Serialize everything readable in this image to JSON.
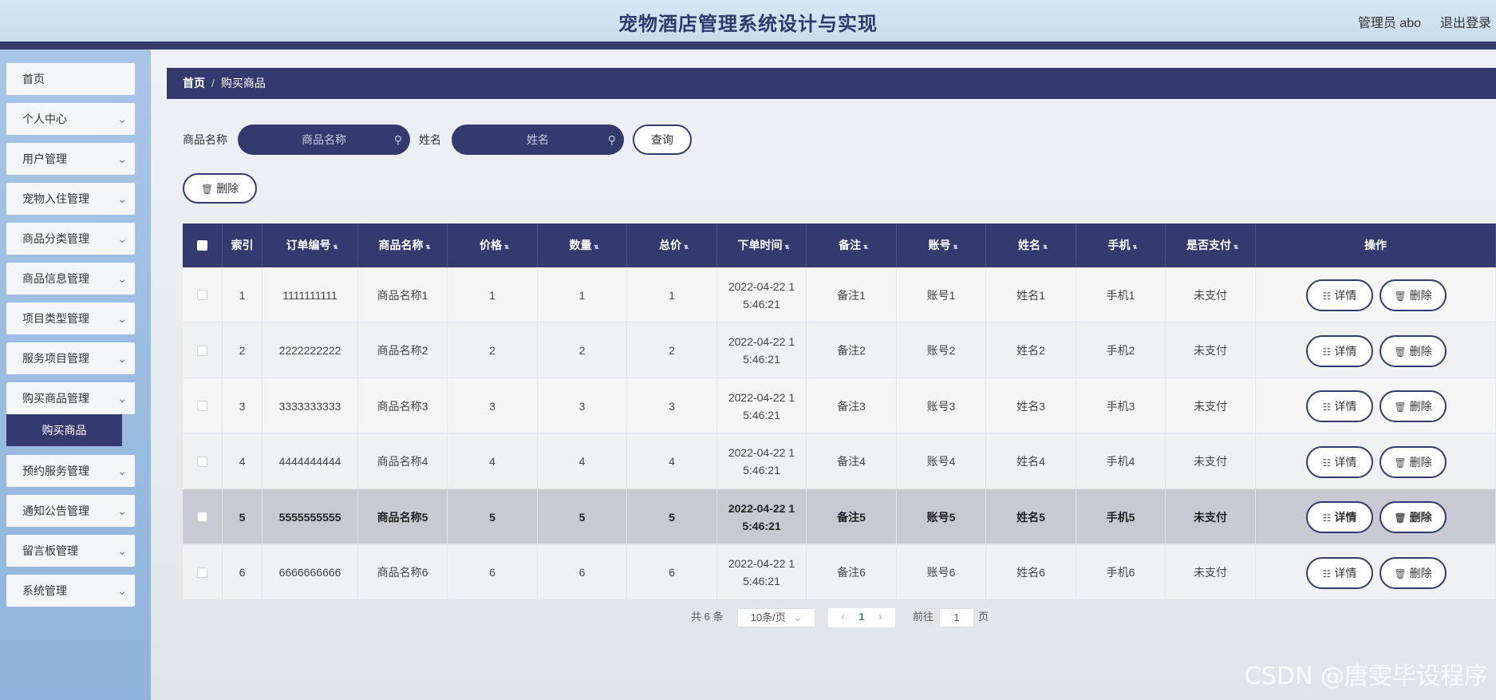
{
  "header": {
    "title": "宠物酒店管理系统设计与实现",
    "user": "管理员 abo",
    "logout": "退出登录"
  },
  "sidebar": {
    "items": [
      {
        "label": "首页",
        "chevron": false
      },
      {
        "label": "个人中心",
        "chevron": true
      },
      {
        "label": "用户管理",
        "chevron": true
      },
      {
        "label": "宠物入住管理",
        "chevron": true
      },
      {
        "label": "商品分类管理",
        "chevron": true
      },
      {
        "label": "商品信息管理",
        "chevron": true
      },
      {
        "label": "项目类型管理",
        "chevron": true
      },
      {
        "label": "服务项目管理",
        "chevron": true
      },
      {
        "label": "购买商品管理",
        "chevron": true
      },
      {
        "label": "预约服务管理",
        "chevron": true
      },
      {
        "label": "通知公告管理",
        "chevron": true
      },
      {
        "label": "留言板管理",
        "chevron": true
      },
      {
        "label": "系统管理",
        "chevron": true
      }
    ],
    "active_sub": "购买商品"
  },
  "breadcrumb": {
    "home": "首页",
    "separator": "/",
    "current": "购买商品"
  },
  "search": {
    "product_label": "商品名称",
    "product_placeholder": "商品名称",
    "name_label": "姓名",
    "name_placeholder": "姓名",
    "query_button": "查询",
    "delete_button": "删除"
  },
  "table": {
    "headers": [
      "索引",
      "订单编号",
      "商品名称",
      "价格",
      "数量",
      "总价",
      "下单时间",
      "备注",
      "账号",
      "姓名",
      "手机",
      "是否支付",
      "操作"
    ],
    "rows": [
      {
        "index": "1",
        "order": "1111111111",
        "product": "商品名称1",
        "price": "1",
        "qty": "1",
        "total": "1",
        "time": "2022-04-22 15:46:21",
        "note": "备注1",
        "account": "账号1",
        "name": "姓名1",
        "phone": "手机1",
        "paid": "未支付"
      },
      {
        "index": "2",
        "order": "2222222222",
        "product": "商品名称2",
        "price": "2",
        "qty": "2",
        "total": "2",
        "time": "2022-04-22 15:46:21",
        "note": "备注2",
        "account": "账号2",
        "name": "姓名2",
        "phone": "手机2",
        "paid": "未支付"
      },
      {
        "index": "3",
        "order": "3333333333",
        "product": "商品名称3",
        "price": "3",
        "qty": "3",
        "total": "3",
        "time": "2022-04-22 15:46:21",
        "note": "备注3",
        "account": "账号3",
        "name": "姓名3",
        "phone": "手机3",
        "paid": "未支付"
      },
      {
        "index": "4",
        "order": "4444444444",
        "product": "商品名称4",
        "price": "4",
        "qty": "4",
        "total": "4",
        "time": "2022-04-22 15:46:21",
        "note": "备注4",
        "account": "账号4",
        "name": "姓名4",
        "phone": "手机4",
        "paid": "未支付"
      },
      {
        "index": "5",
        "order": "5555555555",
        "product": "商品名称5",
        "price": "5",
        "qty": "5",
        "total": "5",
        "time": "2022-04-22 15:46:21",
        "note": "备注5",
        "account": "账号5",
        "name": "姓名5",
        "phone": "手机5",
        "paid": "未支付"
      },
      {
        "index": "6",
        "order": "6666666666",
        "product": "商品名称6",
        "price": "6",
        "qty": "6",
        "total": "6",
        "time": "2022-04-22 15:46:21",
        "note": "备注6",
        "account": "账号6",
        "name": "姓名6",
        "phone": "手机6",
        "paid": "未支付"
      }
    ],
    "detail_button": "详情",
    "row_delete_button": "删除"
  },
  "pagination": {
    "total": "共 6 条",
    "page_size": "10条/页",
    "current_page": "1",
    "goto_label": "前往",
    "goto_value": "1",
    "page_suffix": "页"
  },
  "watermark": "CSDN @唐雯毕设程序",
  "colors": {
    "primary": "#353a6e",
    "sidebar": "#a8c6e6",
    "header": "#d7e6f3"
  }
}
